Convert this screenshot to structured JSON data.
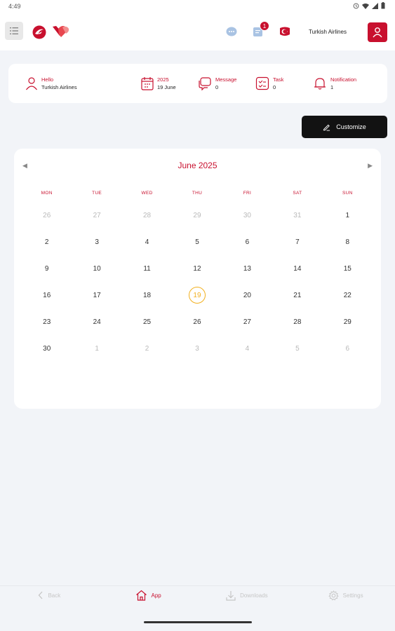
{
  "status_bar": {
    "time": "4:49"
  },
  "header": {
    "user_name": "Turkish Airlines",
    "notification_badge": "1"
  },
  "info_bar": {
    "greeting": {
      "label": "Hello",
      "value": "Turkish Airlines"
    },
    "date": {
      "label": "2025",
      "value": "19 June"
    },
    "message": {
      "label": "Message",
      "value": "0"
    },
    "task": {
      "label": "Task",
      "value": "0"
    },
    "notification": {
      "label": "Notification",
      "value": "1"
    }
  },
  "customize_label": "Customize",
  "calendar": {
    "title": "June 2025",
    "weekdays": [
      "MON",
      "TUE",
      "WED",
      "THU",
      "FRI",
      "SAT",
      "SUN"
    ],
    "weeks": [
      [
        "26",
        "27",
        "28",
        "29",
        "30",
        "31",
        "1"
      ],
      [
        "2",
        "3",
        "4",
        "5",
        "6",
        "7",
        "8"
      ],
      [
        "9",
        "10",
        "11",
        "12",
        "13",
        "14",
        "15"
      ],
      [
        "16",
        "17",
        "18",
        "19",
        "20",
        "21",
        "22"
      ],
      [
        "23",
        "24",
        "25",
        "26",
        "27",
        "28",
        "29"
      ],
      [
        "30",
        "1",
        "2",
        "3",
        "4",
        "5",
        "6"
      ]
    ],
    "muted": [
      [
        true,
        true,
        true,
        true,
        true,
        true,
        false
      ],
      [
        false,
        false,
        false,
        false,
        false,
        false,
        false
      ],
      [
        false,
        false,
        false,
        false,
        false,
        false,
        false
      ],
      [
        false,
        false,
        false,
        false,
        false,
        false,
        false
      ],
      [
        false,
        false,
        false,
        false,
        false,
        false,
        false
      ],
      [
        false,
        true,
        true,
        true,
        true,
        true,
        true
      ]
    ],
    "today": "19"
  },
  "bottom_nav": {
    "back": "Back",
    "app": "App",
    "downloads": "Downloads",
    "settings": "Settings"
  },
  "colors": {
    "brand_red": "#c8102e",
    "today_ring": "#f2b01e",
    "button_dark": "#121212",
    "background": "#f2f4f8"
  }
}
